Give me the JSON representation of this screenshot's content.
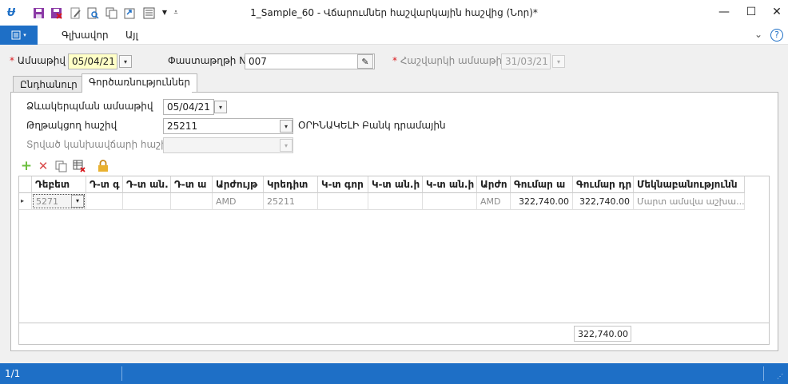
{
  "window": {
    "title": "1_Sample_60 - Վճարումներ հաշվարկային հաշվից (Նոր)*",
    "minimize": "—",
    "maximize": "☐",
    "close": "✕"
  },
  "menu": {
    "main_label": "Գլխավոր",
    "other_label": "Այլ",
    "collapse_glyph": "⌄",
    "help_glyph": "?"
  },
  "form": {
    "date_label": "Ամսաթիվ",
    "date_value": "05/04/21",
    "document_label": "Փաստաթղթի N",
    "document_value": "007",
    "report_date_label": "Հաշվարկի ամսաթիվ",
    "report_date_value": "31/03/21",
    "required_mark": "*"
  },
  "tabs": [
    {
      "label": "Ընդհանուր"
    },
    {
      "label": "Գործառնություններ"
    }
  ],
  "operations": {
    "formation_date_label": "Ձևակերպման ամսաթիվ",
    "formation_date_value": "05/04/21",
    "payer_account_label": "Թղթակցող հաշիվ",
    "payer_account_value": "25211",
    "payer_account_name": "ՕՐԻՆԱԿԵԼԻ Բանկ դրամային",
    "given_account_label": "Տրված կանխավճարի հաշիվ",
    "given_account_value": ""
  },
  "grid": {
    "headers": [
      "Դեբետ",
      "Դ-տ գ",
      "Դ-տ ան.",
      "Դ-տ ա",
      "Արժույթ",
      "Կրեդիտ",
      "Կ-տ գոր",
      "Կ-տ ան.ի",
      "Կ-տ ան.ի",
      "Արժո",
      "Գումար ա",
      "Գումար դր",
      "Մեկնաբանությունն"
    ],
    "rows": [
      [
        "5271",
        "",
        "",
        "",
        "AMD",
        "25211",
        "",
        "",
        "",
        "AMD",
        "322,740.00",
        "322,740.00",
        "Մարտ ամսվա աշխա..."
      ]
    ],
    "total": "322,740.00",
    "row_indicator": "▸"
  },
  "status": {
    "record": "1/1"
  },
  "colors": {
    "accent": "#1e6fc6",
    "required": "#d9161b",
    "yellow_field": "#ffffc6"
  },
  "icons": [
    "app-logo-icon",
    "save-icon",
    "save-close-icon",
    "edit-icon",
    "preview-icon",
    "copy-icon",
    "export-icon",
    "report-icon",
    "dropdown-icon",
    "customize-icon",
    "add-row-icon",
    "delete-row-icon",
    "copy-row-icon",
    "table-delete-icon",
    "lock-icon",
    "browse-icon"
  ]
}
